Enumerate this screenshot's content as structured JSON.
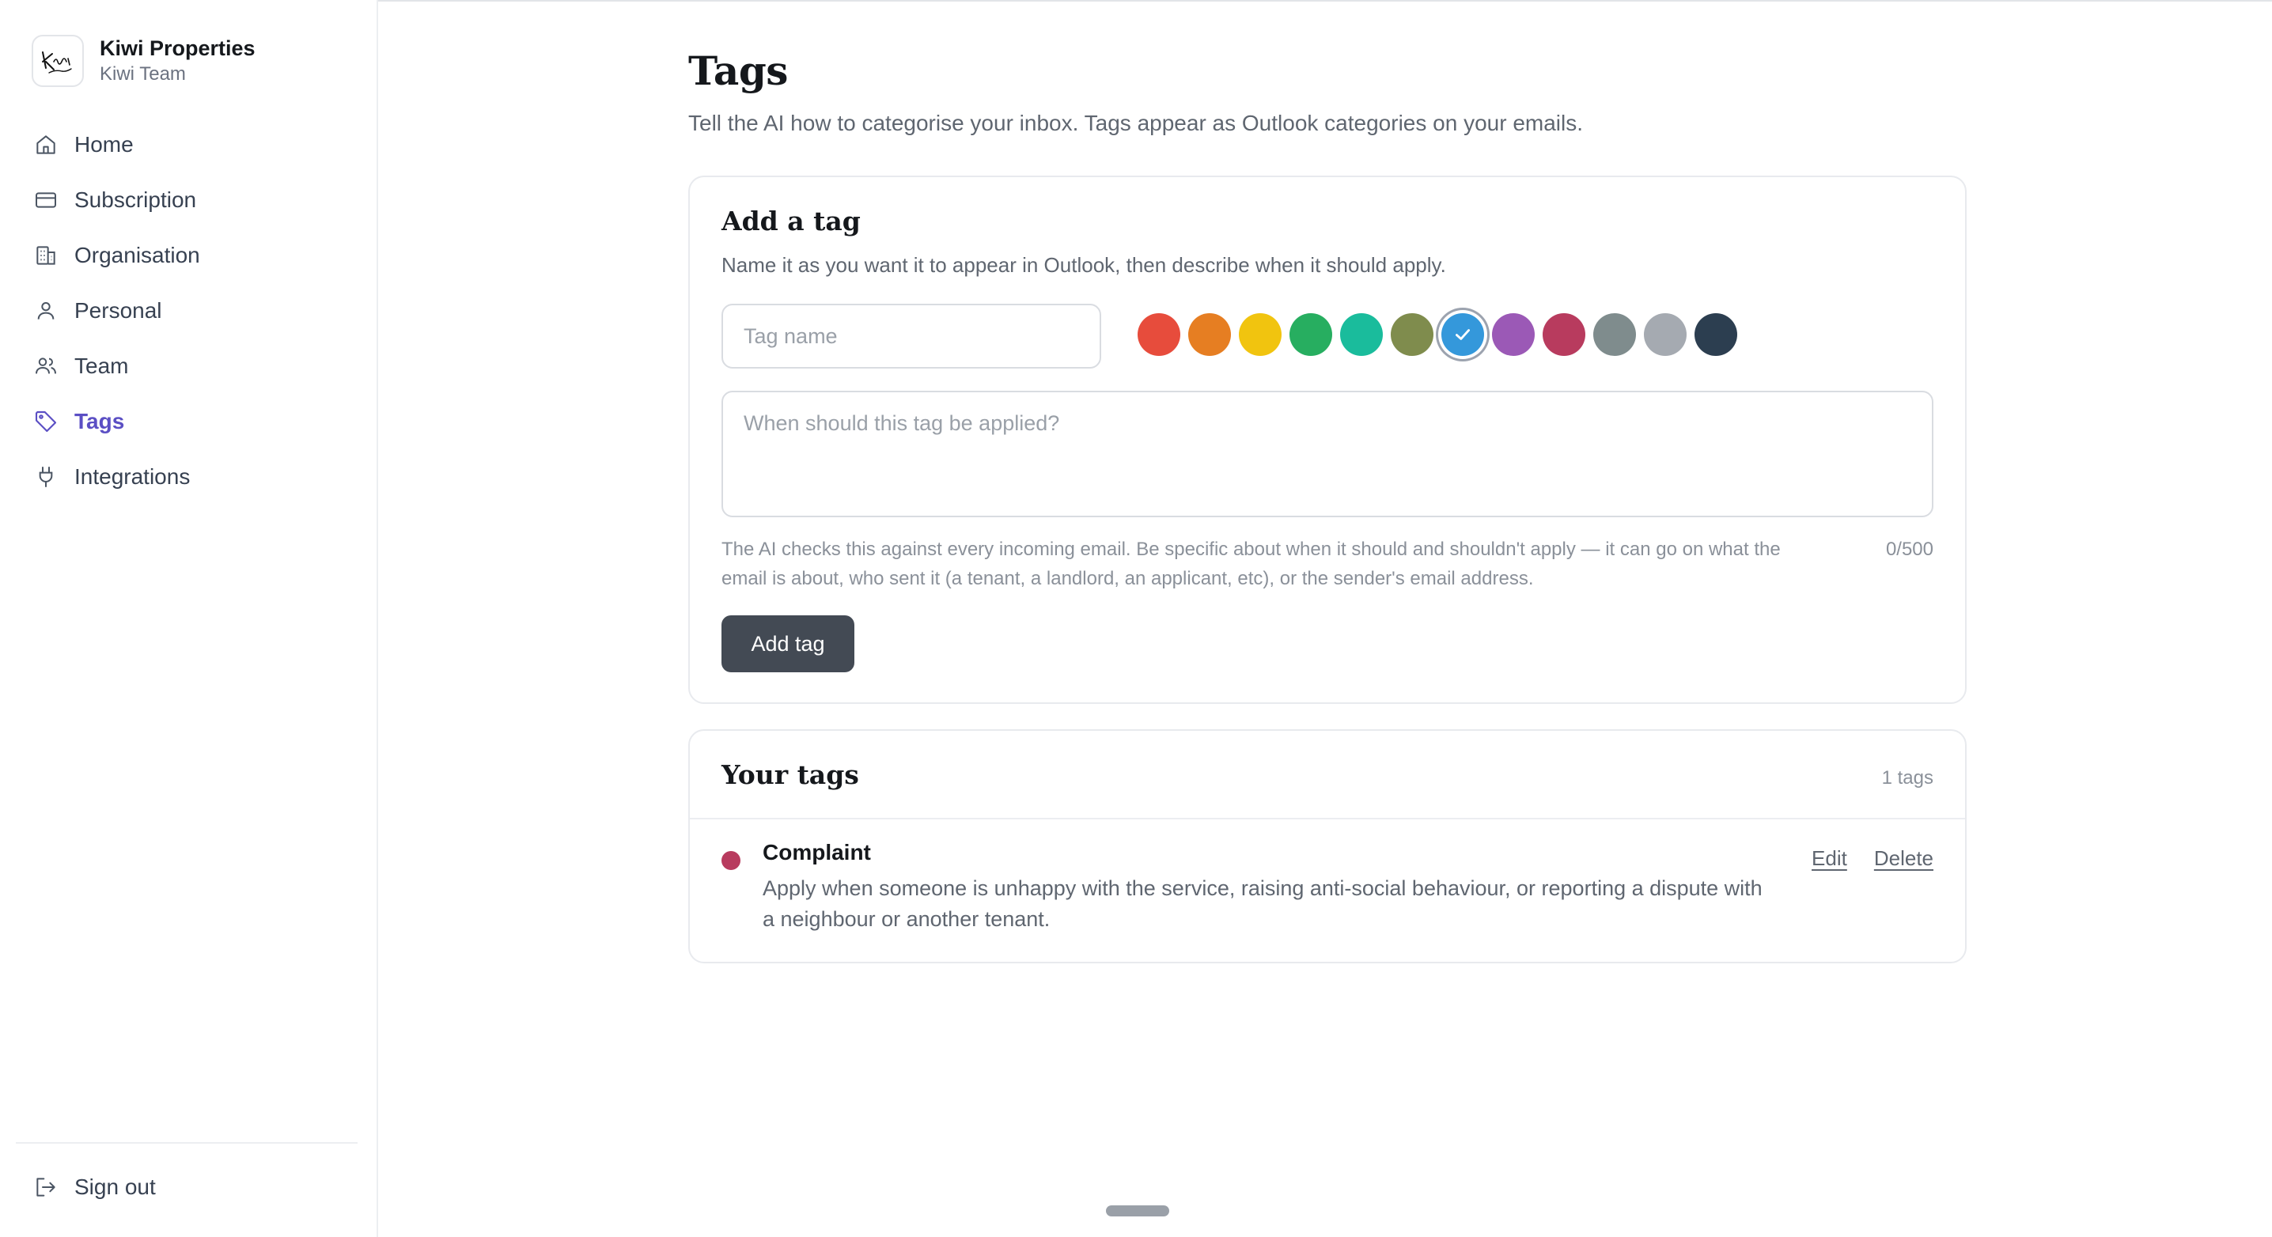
{
  "brand": {
    "name": "Kiwi Properties",
    "team": "Kiwi Team",
    "logo_text": "Kiwi Properties"
  },
  "sidebar": {
    "items": [
      {
        "label": "Home",
        "icon": "home-icon",
        "active": false
      },
      {
        "label": "Subscription",
        "icon": "credit-card-icon",
        "active": false
      },
      {
        "label": "Organisation",
        "icon": "building-icon",
        "active": false
      },
      {
        "label": "Personal",
        "icon": "user-icon",
        "active": false
      },
      {
        "label": "Team",
        "icon": "users-icon",
        "active": false
      },
      {
        "label": "Tags",
        "icon": "tag-icon",
        "active": true
      },
      {
        "label": "Integrations",
        "icon": "plug-icon",
        "active": false
      }
    ],
    "sign_out": "Sign out"
  },
  "page": {
    "title": "Tags",
    "subtitle": "Tell the AI how to categorise your inbox. Tags appear as Outlook categories on your emails."
  },
  "add_card": {
    "title": "Add a tag",
    "description": "Name it as you want it to appear in Outlook, then describe when it should apply.",
    "name_placeholder": "Tag name",
    "name_value": "",
    "colors": [
      "#e74c3c",
      "#e67e22",
      "#f1c40f",
      "#27ae60",
      "#1abc9c",
      "#7f8c4d",
      "#3498db",
      "#9b59b6",
      "#b83b5e",
      "#7f8c8d",
      "#a5aab1",
      "#2c3e50"
    ],
    "selected_color_index": 6,
    "description_placeholder": "When should this tag be applied?",
    "description_value": "",
    "hint": "The AI checks this against every incoming email. Be specific about when it should and shouldn't apply — it can go on what the email is about, who sent it (a tenant, a landlord, an applicant, etc), or the sender's email address.",
    "counter": "0/500",
    "submit_label": "Add tag"
  },
  "list_card": {
    "title": "Your tags",
    "count_label": "1 tags",
    "tags": [
      {
        "name": "Complaint",
        "color": "#b83b5e",
        "description": "Apply when someone is unhappy with the service, raising anti-social behaviour, or reporting a dispute with a neighbour or another tenant.",
        "edit_label": "Edit",
        "delete_label": "Delete"
      }
    ]
  }
}
